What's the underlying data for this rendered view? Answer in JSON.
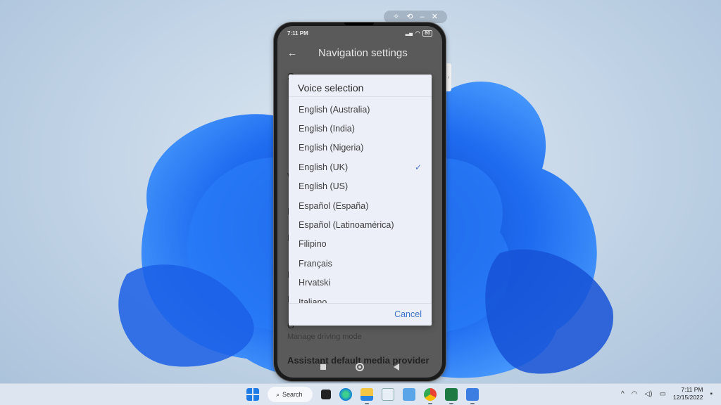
{
  "window_controls": {
    "pin": "pin-icon",
    "history": "history-icon",
    "minimize": "–",
    "close": "✕"
  },
  "phone": {
    "status_bar": {
      "time": "7:11 PM",
      "battery": "80"
    },
    "app_bar": {
      "title": "Navigation settings"
    },
    "background_rows": [
      {
        "text": "S"
      },
      {
        "text": "W"
      },
      {
        "text": "F"
      },
      {
        "text": "F"
      },
      {
        "text": "F"
      },
      {
        "text": "F"
      },
      {
        "text": "G"
      }
    ],
    "background_sub": "Manage driving mode",
    "background_bottom": "Assistant default media provider"
  },
  "dialog": {
    "title": "Voice selection",
    "options": [
      {
        "label": "English (Australia)",
        "selected": false
      },
      {
        "label": "English (India)",
        "selected": false
      },
      {
        "label": "English (Nigeria)",
        "selected": false
      },
      {
        "label": "English (UK)",
        "selected": true
      },
      {
        "label": "English (US)",
        "selected": false
      },
      {
        "label": "Español (España)",
        "selected": false
      },
      {
        "label": "Español (Latinoamérica)",
        "selected": false
      },
      {
        "label": "Filipino",
        "selected": false
      },
      {
        "label": "Français",
        "selected": false
      },
      {
        "label": "Hrvatski",
        "selected": false
      },
      {
        "label": "Italiano",
        "selected": false
      }
    ],
    "check_glyph": "✓",
    "cancel_label": "Cancel",
    "accent_color": "#3d73c8"
  },
  "taskbar": {
    "search_label": "Search",
    "apps": [
      "start",
      "task-view",
      "edge",
      "file-explorer",
      "notepad",
      "notes",
      "chrome",
      "excel",
      "phone-mirror"
    ],
    "clock_time": "7:11 PM",
    "clock_date": "12/15/2022"
  }
}
